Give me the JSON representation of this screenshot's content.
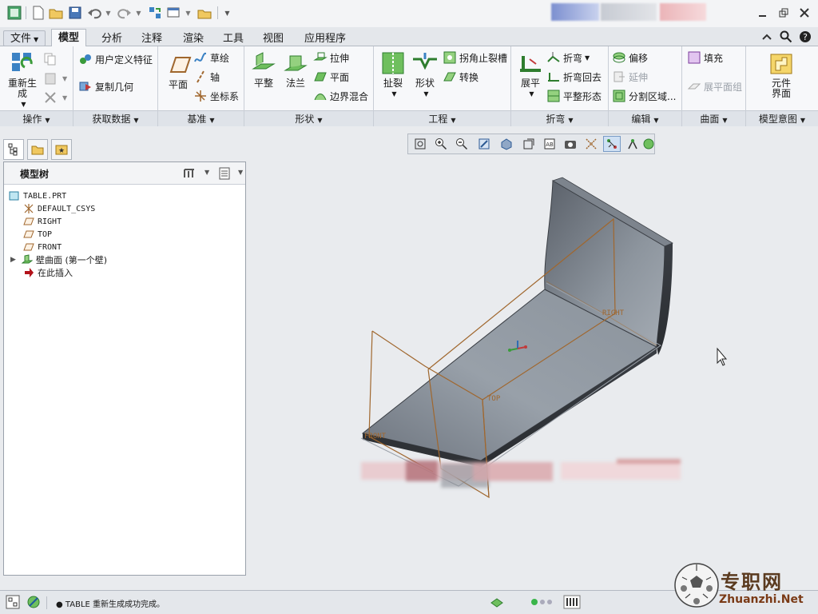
{
  "ribbon_tabs": [
    "文件",
    "模型",
    "分析",
    "注释",
    "渲染",
    "工具",
    "视图",
    "应用程序"
  ],
  "active_tab": "模型",
  "groups": {
    "operations": {
      "label": "操作",
      "regenerate": "重新生成"
    },
    "get_data": {
      "label": "获取数据",
      "user_feature": "用户定义特征",
      "copy_geometry": "复制几何"
    },
    "datum": {
      "label": "基准",
      "plane": "平面",
      "sketch": "草绘",
      "axis": "轴",
      "csys": "坐标系"
    },
    "shapes": {
      "label": "形状",
      "flat": "平整",
      "flange": "法兰",
      "extrude": "拉伸",
      "planar": "平面",
      "blend": "边界混合"
    },
    "engineering": {
      "label": "工程",
      "rip": "扯裂",
      "form": "形状",
      "corner_relief": "拐角止裂槽",
      "convert": "转换"
    },
    "bends": {
      "label": "折弯",
      "unbend": "展平",
      "bend": "折弯",
      "bend_back": "折弯回去",
      "flatten": "平整形态"
    },
    "editing": {
      "label": "编辑",
      "offset": "偏移",
      "extend": "延伸",
      "split": "分割区域..."
    },
    "surfaces": {
      "label": "曲面",
      "fill": "填充",
      "flat_pattern": "展平面组"
    },
    "model_intent": {
      "label": "模型意图",
      "component_interface": "元件界面"
    }
  },
  "model_tree": {
    "title": "模型树",
    "items": [
      {
        "label": "TABLE.PRT",
        "icon": "part-icon"
      },
      {
        "label": "DEFAULT_CSYS",
        "icon": "csys-icon"
      },
      {
        "label": "RIGHT",
        "icon": "datum-plane-icon"
      },
      {
        "label": "TOP",
        "icon": "datum-plane-icon"
      },
      {
        "label": "FRONT",
        "icon": "datum-plane-icon"
      },
      {
        "label": "壁曲面 (第一个壁)",
        "icon": "sheetmetal-wall-icon"
      },
      {
        "label": "在此插入",
        "icon": "insert-here-arrow-icon"
      }
    ]
  },
  "viewport": {
    "plane_labels": {
      "right": "RIGHT",
      "top": "TOP",
      "front": "FRONT"
    }
  },
  "status": {
    "message": "● TABLE 重新生成成功完成。"
  },
  "watermark": {
    "cn": "专职网",
    "en": "Zhuanzhi.Net"
  },
  "colors": {
    "accent": "#2f6db5",
    "datum_plane": "#a0672e",
    "part_surface": "#7d8590",
    "insert_arrow": "#b3121a"
  }
}
